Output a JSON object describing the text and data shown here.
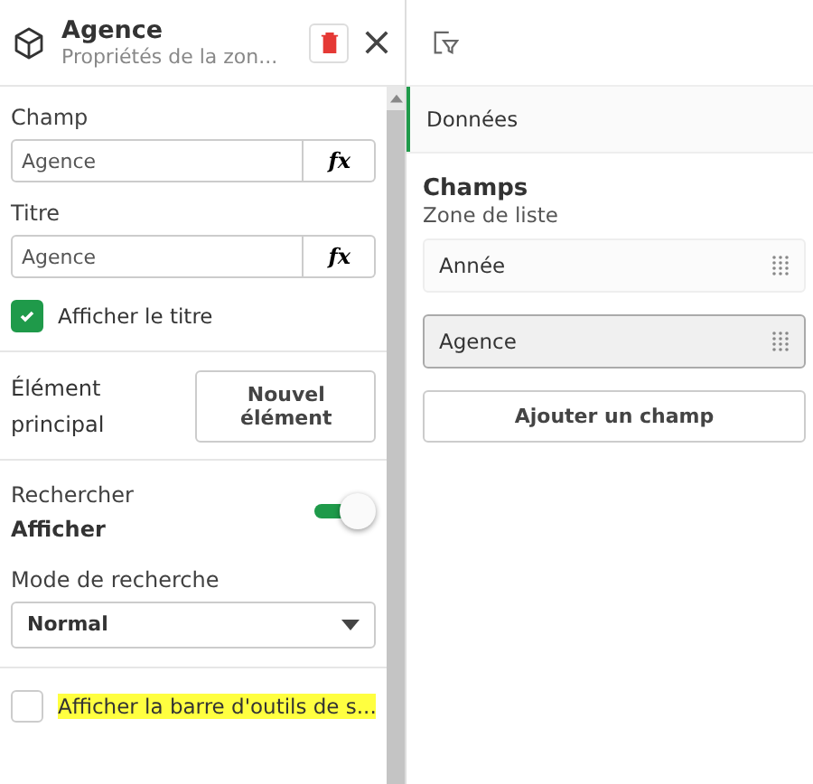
{
  "header": {
    "title": "Agence",
    "subtitle": "Propriétés de la zon..."
  },
  "properties": {
    "field": {
      "label": "Champ",
      "value": "Agence",
      "fx": "fx"
    },
    "title": {
      "label": "Titre",
      "value": "Agence",
      "fx": "fx"
    },
    "show_title": {
      "label": "Afficher le titre",
      "checked": true
    },
    "main_element": {
      "label": "Élément principal",
      "button": "Nouvel élément"
    },
    "search": {
      "label": "Rechercher",
      "value": "Afficher",
      "on": true
    },
    "search_mode": {
      "label": "Mode de recherche",
      "value": "Normal"
    },
    "toolbar": {
      "label": "Afficher la barre d'outils de s...",
      "checked": false,
      "highlighted": true
    }
  },
  "tabs": [
    {
      "label": "Données",
      "selected": true
    }
  ],
  "fields_section": {
    "title": "Champs",
    "subtitle": "Zone de liste",
    "items": [
      {
        "label": "Année",
        "selected": false
      },
      {
        "label": "Agence",
        "selected": true
      }
    ],
    "add_button": "Ajouter un champ"
  }
}
